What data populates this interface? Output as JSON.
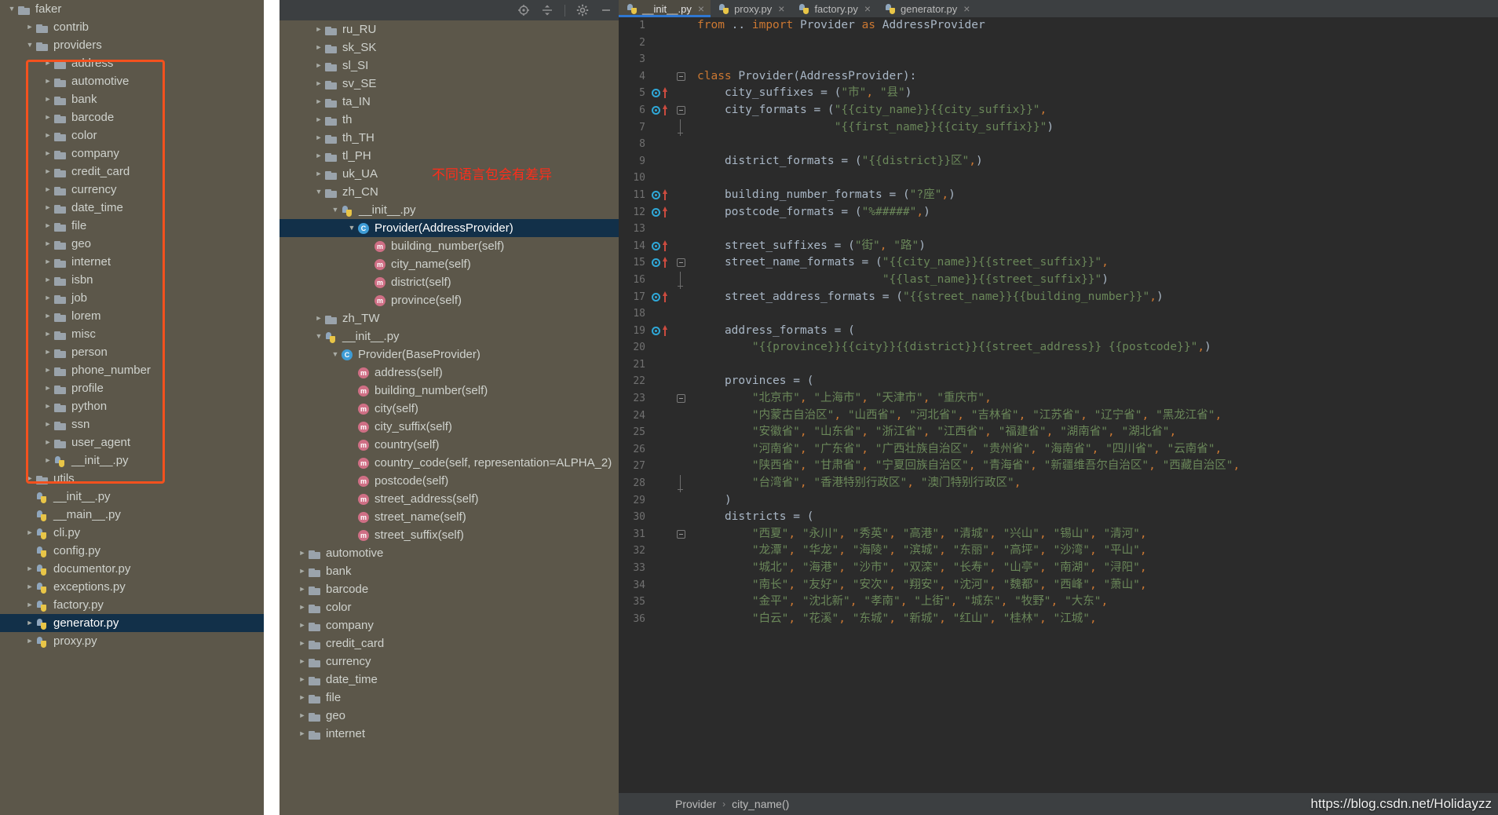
{
  "left_panel": {
    "highlight_color": "#f4511e",
    "items": [
      {
        "depth": 0,
        "arrow": "open",
        "icon": "folder",
        "label": "faker"
      },
      {
        "depth": 1,
        "arrow": "closed",
        "icon": "folder",
        "label": "contrib"
      },
      {
        "depth": 1,
        "arrow": "open",
        "icon": "folder",
        "label": "providers"
      },
      {
        "depth": 2,
        "arrow": "closed",
        "icon": "folder",
        "label": "address"
      },
      {
        "depth": 2,
        "arrow": "closed",
        "icon": "folder",
        "label": "automotive"
      },
      {
        "depth": 2,
        "arrow": "closed",
        "icon": "folder",
        "label": "bank"
      },
      {
        "depth": 2,
        "arrow": "closed",
        "icon": "folder",
        "label": "barcode"
      },
      {
        "depth": 2,
        "arrow": "closed",
        "icon": "folder",
        "label": "color"
      },
      {
        "depth": 2,
        "arrow": "closed",
        "icon": "folder",
        "label": "company"
      },
      {
        "depth": 2,
        "arrow": "closed",
        "icon": "folder",
        "label": "credit_card"
      },
      {
        "depth": 2,
        "arrow": "closed",
        "icon": "folder",
        "label": "currency"
      },
      {
        "depth": 2,
        "arrow": "closed",
        "icon": "folder",
        "label": "date_time"
      },
      {
        "depth": 2,
        "arrow": "closed",
        "icon": "folder",
        "label": "file"
      },
      {
        "depth": 2,
        "arrow": "closed",
        "icon": "folder",
        "label": "geo"
      },
      {
        "depth": 2,
        "arrow": "closed",
        "icon": "folder",
        "label": "internet"
      },
      {
        "depth": 2,
        "arrow": "closed",
        "icon": "folder",
        "label": "isbn"
      },
      {
        "depth": 2,
        "arrow": "closed",
        "icon": "folder",
        "label": "job"
      },
      {
        "depth": 2,
        "arrow": "closed",
        "icon": "folder",
        "label": "lorem"
      },
      {
        "depth": 2,
        "arrow": "closed",
        "icon": "folder",
        "label": "misc"
      },
      {
        "depth": 2,
        "arrow": "closed",
        "icon": "folder",
        "label": "person"
      },
      {
        "depth": 2,
        "arrow": "closed",
        "icon": "folder",
        "label": "phone_number"
      },
      {
        "depth": 2,
        "arrow": "closed",
        "icon": "folder",
        "label": "profile"
      },
      {
        "depth": 2,
        "arrow": "closed",
        "icon": "folder",
        "label": "python"
      },
      {
        "depth": 2,
        "arrow": "closed",
        "icon": "folder",
        "label": "ssn"
      },
      {
        "depth": 2,
        "arrow": "closed",
        "icon": "folder",
        "label": "user_agent"
      },
      {
        "depth": 2,
        "arrow": "closed",
        "icon": "py",
        "label": "__init__.py"
      },
      {
        "depth": 1,
        "arrow": "closed",
        "icon": "folder",
        "label": "utils"
      },
      {
        "depth": 1,
        "arrow": "none",
        "icon": "py",
        "label": "__init__.py"
      },
      {
        "depth": 1,
        "arrow": "none",
        "icon": "py",
        "label": "__main__.py"
      },
      {
        "depth": 1,
        "arrow": "closed",
        "icon": "py",
        "label": "cli.py"
      },
      {
        "depth": 1,
        "arrow": "none",
        "icon": "py",
        "label": "config.py"
      },
      {
        "depth": 1,
        "arrow": "closed",
        "icon": "py",
        "label": "documentor.py"
      },
      {
        "depth": 1,
        "arrow": "closed",
        "icon": "py",
        "label": "exceptions.py"
      },
      {
        "depth": 1,
        "arrow": "closed",
        "icon": "py",
        "label": "factory.py"
      },
      {
        "depth": 1,
        "arrow": "closed",
        "icon": "py",
        "label": "generator.py",
        "selected": true
      },
      {
        "depth": 1,
        "arrow": "closed",
        "icon": "py",
        "label": "proxy.py"
      }
    ]
  },
  "mid_panel": {
    "toolbar": [
      {
        "name": "locate-icon",
        "label": "locate"
      },
      {
        "name": "expand-collapse-icon",
        "label": "expand-collapse"
      },
      {
        "name": "gear-icon",
        "label": "settings"
      },
      {
        "name": "minimize-icon",
        "label": "hide"
      }
    ],
    "annotation": "不同语言包会有差异",
    "annotation_color": "#ff2d1a",
    "items": [
      {
        "depth": 1,
        "arrow": "closed",
        "icon": "folder",
        "label": "ru_RU"
      },
      {
        "depth": 1,
        "arrow": "closed",
        "icon": "folder",
        "label": "sk_SK"
      },
      {
        "depth": 1,
        "arrow": "closed",
        "icon": "folder",
        "label": "sl_SI"
      },
      {
        "depth": 1,
        "arrow": "closed",
        "icon": "folder",
        "label": "sv_SE"
      },
      {
        "depth": 1,
        "arrow": "closed",
        "icon": "folder",
        "label": "ta_IN"
      },
      {
        "depth": 1,
        "arrow": "closed",
        "icon": "folder",
        "label": "th"
      },
      {
        "depth": 1,
        "arrow": "closed",
        "icon": "folder",
        "label": "th_TH"
      },
      {
        "depth": 1,
        "arrow": "closed",
        "icon": "folder",
        "label": "tl_PH"
      },
      {
        "depth": 1,
        "arrow": "closed",
        "icon": "folder",
        "label": "uk_UA"
      },
      {
        "depth": 1,
        "arrow": "open",
        "icon": "folder",
        "label": "zh_CN"
      },
      {
        "depth": 2,
        "arrow": "open",
        "icon": "py",
        "label": "__init__.py"
      },
      {
        "depth": 3,
        "arrow": "open",
        "icon": "cls",
        "label": "Provider(AddressProvider)",
        "selected": true
      },
      {
        "depth": 4,
        "arrow": "none",
        "icon": "mth",
        "label": "building_number(self)"
      },
      {
        "depth": 4,
        "arrow": "none",
        "icon": "mth",
        "label": "city_name(self)"
      },
      {
        "depth": 4,
        "arrow": "none",
        "icon": "mth",
        "label": "district(self)"
      },
      {
        "depth": 4,
        "arrow": "none",
        "icon": "mth",
        "label": "province(self)"
      },
      {
        "depth": 1,
        "arrow": "closed",
        "icon": "folder",
        "label": "zh_TW"
      },
      {
        "depth": 1,
        "arrow": "open",
        "icon": "py",
        "label": "__init__.py"
      },
      {
        "depth": 2,
        "arrow": "open",
        "icon": "cls",
        "label": "Provider(BaseProvider)"
      },
      {
        "depth": 3,
        "arrow": "none",
        "icon": "mth",
        "label": "address(self)"
      },
      {
        "depth": 3,
        "arrow": "none",
        "icon": "mth",
        "label": "building_number(self)"
      },
      {
        "depth": 3,
        "arrow": "none",
        "icon": "mth",
        "label": "city(self)"
      },
      {
        "depth": 3,
        "arrow": "none",
        "icon": "mth",
        "label": "city_suffix(self)"
      },
      {
        "depth": 3,
        "arrow": "none",
        "icon": "mth",
        "label": "country(self)"
      },
      {
        "depth": 3,
        "arrow": "none",
        "icon": "mth",
        "label": "country_code(self, representation=ALPHA_2)"
      },
      {
        "depth": 3,
        "arrow": "none",
        "icon": "mth",
        "label": "postcode(self)"
      },
      {
        "depth": 3,
        "arrow": "none",
        "icon": "mth",
        "label": "street_address(self)"
      },
      {
        "depth": 3,
        "arrow": "none",
        "icon": "mth",
        "label": "street_name(self)"
      },
      {
        "depth": 3,
        "arrow": "none",
        "icon": "mth",
        "label": "street_suffix(self)"
      },
      {
        "depth": 0,
        "arrow": "closed",
        "icon": "folder",
        "label": "automotive"
      },
      {
        "depth": 0,
        "arrow": "closed",
        "icon": "folder",
        "label": "bank"
      },
      {
        "depth": 0,
        "arrow": "closed",
        "icon": "folder",
        "label": "barcode"
      },
      {
        "depth": 0,
        "arrow": "closed",
        "icon": "folder",
        "label": "color"
      },
      {
        "depth": 0,
        "arrow": "closed",
        "icon": "folder",
        "label": "company"
      },
      {
        "depth": 0,
        "arrow": "closed",
        "icon": "folder",
        "label": "credit_card"
      },
      {
        "depth": 0,
        "arrow": "closed",
        "icon": "folder",
        "label": "currency"
      },
      {
        "depth": 0,
        "arrow": "closed",
        "icon": "folder",
        "label": "date_time"
      },
      {
        "depth": 0,
        "arrow": "closed",
        "icon": "folder",
        "label": "file"
      },
      {
        "depth": 0,
        "arrow": "closed",
        "icon": "folder",
        "label": "geo"
      },
      {
        "depth": 0,
        "arrow": "closed",
        "icon": "folder",
        "label": "internet"
      }
    ]
  },
  "editor": {
    "tabs": [
      {
        "label": "__init__.py",
        "active": true,
        "closable": true
      },
      {
        "label": "proxy.py",
        "active": false,
        "closable": true
      },
      {
        "label": "factory.py",
        "active": false,
        "closable": true
      },
      {
        "label": "generator.py",
        "active": false,
        "closable": true
      }
    ],
    "lines": [
      {
        "n": "1",
        "bp": false,
        "up": false,
        "fold": "",
        "text": "from .. import Provider as AddressProvider",
        "kind": "import"
      },
      {
        "n": "2",
        "bp": false,
        "up": false,
        "fold": "",
        "text": "",
        "kind": "plain"
      },
      {
        "n": "3",
        "bp": false,
        "up": false,
        "fold": "",
        "text": "",
        "kind": "plain"
      },
      {
        "n": "4",
        "bp": false,
        "up": false,
        "fold": "minus",
        "text": "class Provider(AddressProvider):",
        "kind": "class"
      },
      {
        "n": "5",
        "bp": true,
        "up": true,
        "fold": "",
        "text": "    city_suffixes = (\"市\", \"县\")",
        "kind": "code"
      },
      {
        "n": "6",
        "bp": true,
        "up": true,
        "fold": "minus",
        "text": "    city_formats = (\"{{city_name}}{{city_suffix}}\",",
        "kind": "code"
      },
      {
        "n": "7",
        "bp": false,
        "up": false,
        "fold": "end",
        "text": "                    \"{{first_name}}{{city_suffix}}\")",
        "kind": "code"
      },
      {
        "n": "8",
        "bp": false,
        "up": false,
        "fold": "",
        "text": "",
        "kind": "plain"
      },
      {
        "n": "9",
        "bp": false,
        "up": false,
        "fold": "",
        "text": "    district_formats = (\"{{district}}区\",)",
        "kind": "code"
      },
      {
        "n": "10",
        "bp": false,
        "up": false,
        "fold": "",
        "text": "",
        "kind": "plain"
      },
      {
        "n": "11",
        "bp": true,
        "up": true,
        "fold": "",
        "text": "    building_number_formats = (\"?座\",)",
        "kind": "code"
      },
      {
        "n": "12",
        "bp": true,
        "up": true,
        "fold": "",
        "text": "    postcode_formats = (\"%#####\",)",
        "kind": "code"
      },
      {
        "n": "13",
        "bp": false,
        "up": false,
        "fold": "",
        "text": "",
        "kind": "plain"
      },
      {
        "n": "14",
        "bp": true,
        "up": true,
        "fold": "",
        "text": "    street_suffixes = (\"街\", \"路\")",
        "kind": "code"
      },
      {
        "n": "15",
        "bp": true,
        "up": true,
        "fold": "minus",
        "text": "    street_name_formats = (\"{{city_name}}{{street_suffix}}\",",
        "kind": "code"
      },
      {
        "n": "16",
        "bp": false,
        "up": false,
        "fold": "end",
        "text": "                           \"{{last_name}}{{street_suffix}}\")",
        "kind": "code"
      },
      {
        "n": "17",
        "bp": true,
        "up": true,
        "fold": "",
        "text": "    street_address_formats = (\"{{street_name}}{{building_number}}\",)",
        "kind": "code"
      },
      {
        "n": "18",
        "bp": false,
        "up": false,
        "fold": "",
        "text": "",
        "kind": "plain"
      },
      {
        "n": "19",
        "bp": true,
        "up": true,
        "fold": "",
        "text": "    address_formats = (",
        "kind": "code"
      },
      {
        "n": "20",
        "bp": false,
        "up": false,
        "fold": "",
        "text": "        \"{{province}}{{city}}{{district}}{{street_address}} {{postcode}}\",)",
        "kind": "code"
      },
      {
        "n": "21",
        "bp": false,
        "up": false,
        "fold": "",
        "text": "",
        "kind": "plain"
      },
      {
        "n": "22",
        "bp": false,
        "up": false,
        "fold": "",
        "text": "    provinces = (",
        "kind": "code"
      },
      {
        "n": "23",
        "bp": false,
        "up": false,
        "fold": "minus",
        "text": "        \"北京市\", \"上海市\", \"天津市\", \"重庆市\",",
        "kind": "code"
      },
      {
        "n": "24",
        "bp": false,
        "up": false,
        "fold": "",
        "text": "        \"内蒙古自治区\", \"山西省\", \"河北省\", \"吉林省\", \"江苏省\", \"辽宁省\", \"黑龙江省\",",
        "kind": "code"
      },
      {
        "n": "25",
        "bp": false,
        "up": false,
        "fold": "",
        "text": "        \"安徽省\", \"山东省\", \"浙江省\", \"江西省\", \"福建省\", \"湖南省\", \"湖北省\",",
        "kind": "code"
      },
      {
        "n": "26",
        "bp": false,
        "up": false,
        "fold": "",
        "text": "        \"河南省\", \"广东省\", \"广西壮族自治区\", \"贵州省\", \"海南省\", \"四川省\", \"云南省\",",
        "kind": "code"
      },
      {
        "n": "27",
        "bp": false,
        "up": false,
        "fold": "",
        "text": "        \"陕西省\", \"甘肃省\", \"宁夏回族自治区\", \"青海省\", \"新疆维吾尔自治区\", \"西藏自治区\",",
        "kind": "code"
      },
      {
        "n": "28",
        "bp": false,
        "up": false,
        "fold": "end",
        "text": "        \"台湾省\", \"香港特别行政区\", \"澳门特别行政区\",",
        "kind": "code"
      },
      {
        "n": "29",
        "bp": false,
        "up": false,
        "fold": "",
        "text": "    )",
        "kind": "code"
      },
      {
        "n": "30",
        "bp": false,
        "up": false,
        "fold": "",
        "text": "    districts = (",
        "kind": "code"
      },
      {
        "n": "31",
        "bp": false,
        "up": false,
        "fold": "minus",
        "text": "        \"西夏\", \"永川\", \"秀英\", \"高港\", \"清城\", \"兴山\", \"锡山\", \"清河\",",
        "kind": "code"
      },
      {
        "n": "32",
        "bp": false,
        "up": false,
        "fold": "",
        "text": "        \"龙潭\", \"华龙\", \"海陵\", \"滨城\", \"东丽\", \"高坪\", \"沙湾\", \"平山\",",
        "kind": "code"
      },
      {
        "n": "33",
        "bp": false,
        "up": false,
        "fold": "",
        "text": "        \"城北\", \"海港\", \"沙市\", \"双滦\", \"长寿\", \"山亭\", \"南湖\", \"浔阳\",",
        "kind": "code"
      },
      {
        "n": "34",
        "bp": false,
        "up": false,
        "fold": "",
        "text": "        \"南长\", \"友好\", \"安次\", \"翔安\", \"沈河\", \"魏都\", \"西峰\", \"萧山\",",
        "kind": "code"
      },
      {
        "n": "35",
        "bp": false,
        "up": false,
        "fold": "",
        "text": "        \"金平\", \"沈北新\", \"孝南\", \"上街\", \"城东\", \"牧野\", \"大东\",",
        "kind": "code"
      },
      {
        "n": "36",
        "bp": false,
        "up": false,
        "fold": "",
        "text": "        \"白云\", \"花溪\", \"东城\", \"新城\", \"红山\", \"桂林\", \"江城\",",
        "kind": "code"
      }
    ],
    "breadcrumb": [
      "Provider",
      "city_name()"
    ],
    "watermark": "https://blog.csdn.net/Holidayzz"
  }
}
